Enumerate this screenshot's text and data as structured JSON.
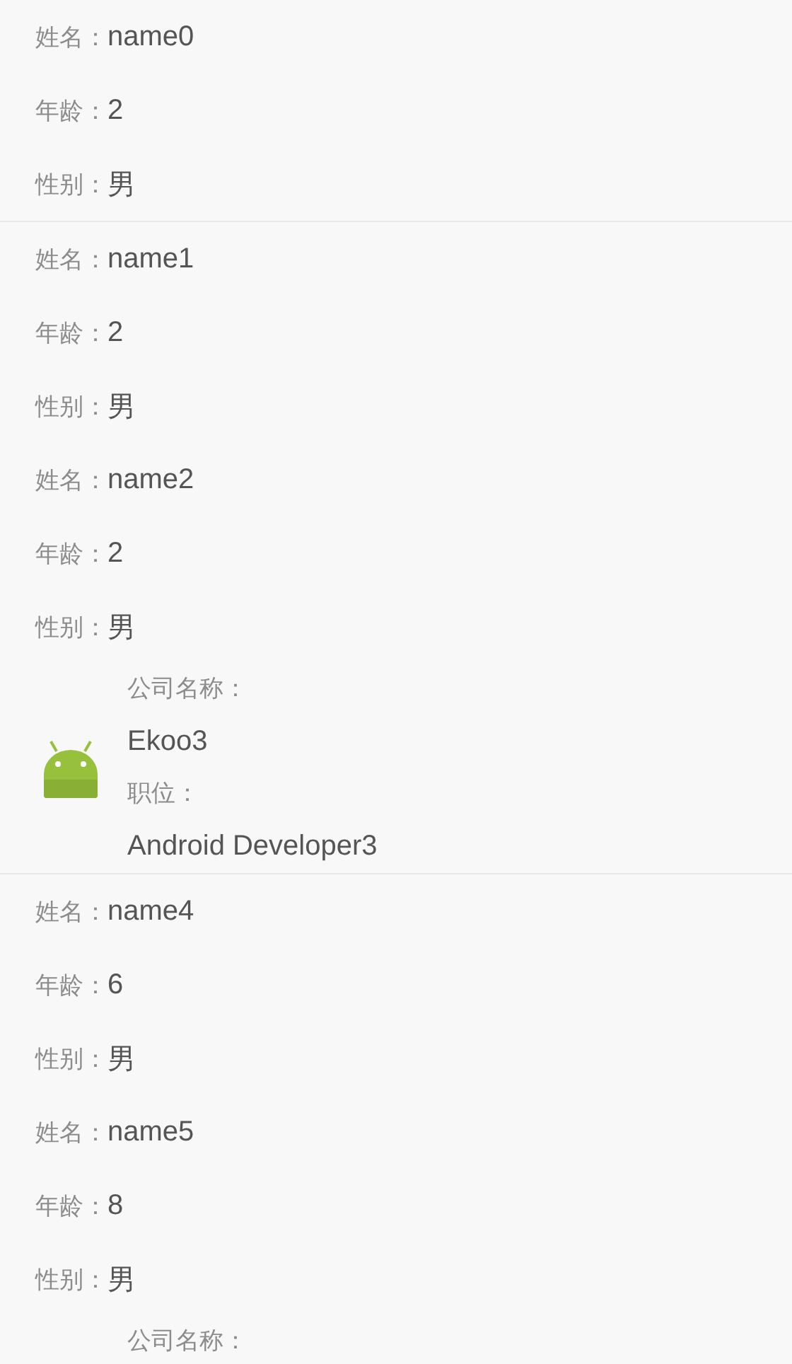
{
  "items": [
    {
      "kind": "person",
      "divider_below": true,
      "fields": [
        {
          "label": "姓名：",
          "value": "name0"
        },
        {
          "label": "年龄：",
          "value": "2"
        },
        {
          "label": "性别：",
          "value": "男"
        }
      ]
    },
    {
      "kind": "person",
      "divider_below": false,
      "fields": [
        {
          "label": "姓名：",
          "value": "name1"
        },
        {
          "label": "年龄：",
          "value": "2"
        },
        {
          "label": "性别：",
          "value": "男"
        }
      ]
    },
    {
      "kind": "person",
      "divider_below": false,
      "fields": [
        {
          "label": "姓名：",
          "value": "name2"
        },
        {
          "label": "年龄：",
          "value": "2"
        },
        {
          "label": "性别：",
          "value": "男"
        }
      ]
    },
    {
      "kind": "company",
      "icon": true,
      "divider_below": true,
      "fields": [
        {
          "label": "公司名称：",
          "value": "Ekoo3"
        },
        {
          "label": "职位：",
          "value": "Android Developer3"
        }
      ]
    },
    {
      "kind": "person",
      "divider_below": false,
      "fields": [
        {
          "label": "姓名：",
          "value": "name4"
        },
        {
          "label": "年龄：",
          "value": "6"
        },
        {
          "label": "性别：",
          "value": "男"
        }
      ]
    },
    {
      "kind": "person",
      "divider_below": false,
      "fields": [
        {
          "label": "姓名：",
          "value": "name5"
        },
        {
          "label": "年龄：",
          "value": "8"
        },
        {
          "label": "性别：",
          "value": "男"
        }
      ]
    },
    {
      "kind": "company",
      "icon": false,
      "divider_below": false,
      "fields": [
        {
          "label": "公司名称："
        }
      ]
    }
  ]
}
